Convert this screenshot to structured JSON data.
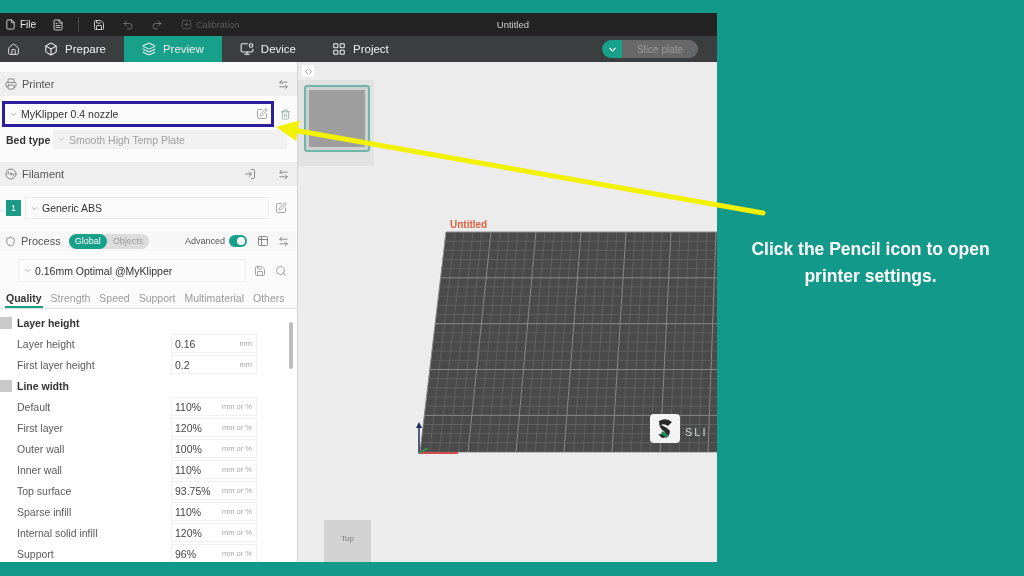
{
  "menu_bar": {
    "file_label": "File",
    "calibration_label": "Calibration",
    "calibration_disabled": true,
    "title": "Untitled"
  },
  "tabs": [
    {
      "label": "Prepare",
      "selected": false
    },
    {
      "label": "Preview",
      "selected": true
    },
    {
      "label": "Device",
      "selected": false
    },
    {
      "label": "Project",
      "selected": false
    }
  ],
  "slice_button": {
    "label": "Slice plate",
    "disabled": true
  },
  "printer": {
    "title": "Printer",
    "preset": "MyKlipper 0.4 nozzle",
    "highlighted": true,
    "bed_type_label": "Bed type",
    "bed_type": "Smooth High Temp Plate"
  },
  "filament": {
    "title": "Filament",
    "slots": [
      {
        "number": "1",
        "color": "#1a9a87",
        "name": "Generic ABS"
      }
    ]
  },
  "process": {
    "title": "Process",
    "scopes": [
      {
        "label": "Global",
        "selected": true
      },
      {
        "label": "Objects",
        "selected": false
      }
    ],
    "advanced": {
      "label": "Advanced",
      "on": true
    },
    "preset": "0.16mm Optimal @MyKlipper",
    "tabs": [
      {
        "label": "Quality",
        "selected": true
      },
      {
        "label": "Strength",
        "selected": false
      },
      {
        "label": "Speed",
        "selected": false
      },
      {
        "label": "Support",
        "selected": false
      },
      {
        "label": "Multimaterial",
        "selected": false
      },
      {
        "label": "Others",
        "selected": false
      }
    ]
  },
  "settings": [
    {
      "group": "Layer height",
      "rows": [
        {
          "label": "Layer height",
          "value": "0.16",
          "unit": "mm"
        },
        {
          "label": "First layer height",
          "value": "0.2",
          "unit": "mm"
        }
      ]
    },
    {
      "group": "Line width",
      "rows": [
        {
          "label": "Default",
          "value": "110%",
          "unit": "mm or %"
        },
        {
          "label": "First layer",
          "value": "120%",
          "unit": "mm or %"
        },
        {
          "label": "Outer wall",
          "value": "100%",
          "unit": "mm or %"
        },
        {
          "label": "Inner wall",
          "value": "110%",
          "unit": "mm or %"
        },
        {
          "label": "Top surface",
          "value": "93.75%",
          "unit": "mm or %"
        },
        {
          "label": "Sparse infill",
          "value": "110%",
          "unit": "mm or %"
        },
        {
          "label": "Internal solid infill",
          "value": "120%",
          "unit": "mm or %"
        },
        {
          "label": "Support",
          "value": "96%",
          "unit": "mm or %"
        }
      ]
    }
  ],
  "canvas": {
    "plate_name": "Untitled",
    "logo_text": "SLI",
    "view_cube_label": "Top"
  },
  "callout": "Click the Pencil icon to open printer settings."
}
